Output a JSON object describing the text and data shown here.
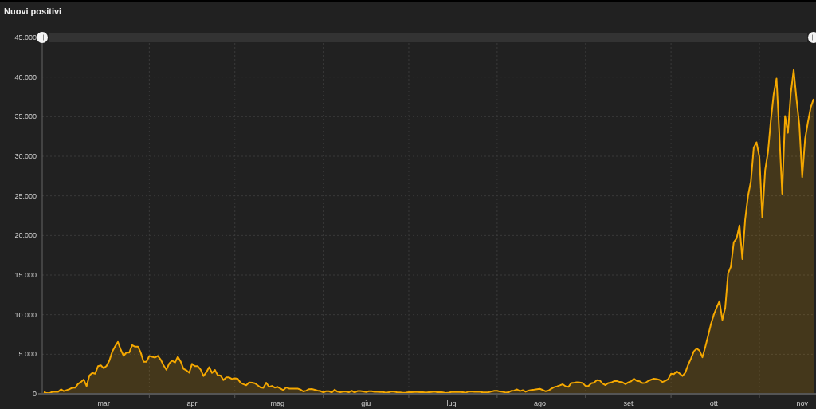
{
  "chart_data": {
    "type": "area",
    "title": "Nuovi positivi",
    "categories": [
      null,
      null,
      null,
      null,
      null,
      null,
      null,
      null,
      null,
      null,
      null,
      null,
      null,
      null,
      null,
      null,
      null,
      null,
      null,
      null,
      null,
      "mar",
      null,
      null,
      null,
      null,
      null,
      null,
      null,
      null,
      null,
      null,
      null,
      null,
      null,
      null,
      null,
      null,
      null,
      null,
      null,
      null,
      null,
      null,
      null,
      null,
      null,
      null,
      null,
      null,
      null,
      null,
      "apr",
      null,
      null,
      null,
      null,
      null,
      null,
      null,
      null,
      null,
      null,
      null,
      null,
      null,
      null,
      null,
      null,
      null,
      null,
      null,
      null,
      null,
      null,
      null,
      null,
      null,
      null,
      null,
      null,
      null,
      "mag",
      null,
      null,
      null,
      null,
      null,
      null,
      null,
      null,
      null,
      null,
      null,
      null,
      null,
      null,
      null,
      null,
      null,
      null,
      null,
      null,
      null,
      null,
      null,
      null,
      null,
      null,
      null,
      null,
      null,
      null,
      "giu",
      null,
      null,
      null,
      null,
      null,
      null,
      null,
      null,
      null,
      null,
      null,
      null,
      null,
      null,
      null,
      null,
      null,
      null,
      null,
      null,
      null,
      null,
      null,
      null,
      null,
      null,
      null,
      null,
      null,
      "lug",
      null,
      null,
      null,
      null,
      null,
      null,
      null,
      null,
      null,
      null,
      null,
      null,
      null,
      null,
      null,
      null,
      null,
      null,
      null,
      null,
      null,
      null,
      null,
      null,
      null,
      null,
      null,
      null,
      null,
      null,
      "ago",
      null,
      null,
      null,
      null,
      null,
      null,
      null,
      null,
      null,
      null,
      null,
      null,
      null,
      null,
      null,
      null,
      null,
      null,
      null,
      null,
      null,
      null,
      null,
      null,
      null,
      null,
      null,
      null,
      null,
      null,
      "set",
      null,
      null,
      null,
      null,
      null,
      null,
      null,
      null,
      null,
      null,
      null,
      null,
      null,
      null,
      null,
      null,
      null,
      null,
      null,
      null,
      null,
      null,
      null,
      null,
      null,
      null,
      null,
      null,
      null,
      "ott",
      null,
      null,
      null,
      null,
      null,
      null,
      null,
      null,
      null,
      null,
      null,
      null,
      null,
      null,
      null,
      null,
      null,
      null,
      null,
      null,
      null,
      null,
      null,
      null,
      null,
      null,
      null,
      null,
      null,
      null,
      "nov",
      null,
      null,
      null,
      null
    ],
    "series": [
      {
        "color": "#f5a800",
        "values": [
          221,
          93,
          78,
          250,
          238,
          240,
          566,
          342,
          466,
          587,
          769,
          778,
          1247,
          1492,
          1797,
          977,
          2313,
          2651,
          2547,
          3497,
          3590,
          3233,
          3526,
          4207,
          5322,
          5986,
          6557,
          5560,
          4789,
          5249,
          5210,
          6153,
          5959,
          5974,
          5217,
          4050,
          4053,
          4782,
          4668,
          4585,
          4805,
          4316,
          3599,
          3039,
          3836,
          4204,
          3951,
          4694,
          4092,
          3153,
          2972,
          2667,
          3786,
          3493,
          3491,
          3047,
          2256,
          2729,
          3370,
          2646,
          3021,
          2357,
          2324,
          1739,
          2091,
          2086,
          1872,
          1965,
          1900,
          1389,
          1221,
          1075,
          1444,
          1401,
          1327,
          1083,
          802,
          744,
          1402,
          888,
          992,
          789,
          875,
          675,
          451,
          813,
          665,
          642,
          652,
          669,
          531,
          300,
          397,
          584,
          593,
          516,
          416,
          355,
          178,
          318,
          321,
          177,
          518,
          270,
          197,
          280,
          283,
          202,
          379,
          163,
          346,
          338,
          301,
          210,
          329,
          333,
          251,
          262,
          224,
          218,
          122,
          190,
          296,
          259,
          175,
          174,
          126,
          142,
          187,
          201,
          223,
          235,
          192,
          208,
          138,
          193,
          229,
          276,
          188,
          234,
          169,
          114,
          162,
          230,
          233,
          249,
          219,
          190,
          129,
          282,
          306,
          252,
          275,
          255,
          170,
          181,
          212,
          289,
          386,
          379,
          295,
          239,
          159,
          190,
          384,
          402,
          552,
          347,
          463,
          259,
          412,
          481,
          523,
          574,
          629,
          479,
          320,
          403,
          642,
          845,
          947,
          1071,
          1210,
          953,
          878,
          1367,
          1411,
          1462,
          1444,
          1365,
          996,
          978,
          1326,
          1397,
          1733,
          1695,
          1297,
          1108,
          1370,
          1434,
          1597,
          1616,
          1501,
          1458,
          1229,
          1452,
          1585,
          1907,
          1638,
          1587,
          1350,
          1392,
          1640,
          1786,
          1912,
          1869,
          1766,
          1494,
          1648,
          1851,
          2548,
          2499,
          2844,
          2578,
          2257,
          2677,
          3678,
          4458,
          5372,
          5724,
          5456,
          4619,
          5901,
          7332,
          8804,
          10010,
          10925,
          11705,
          9338,
          10874,
          15199,
          16079,
          19143,
          19644,
          21273,
          17012,
          21994,
          24991,
          26831,
          31084,
          31758,
          29907,
          22253,
          28244,
          30550,
          34505,
          37809,
          39811,
          32616,
          25271,
          35098,
          32961,
          37978,
          40902,
          37255,
          33979,
          27354,
          32191,
          34283,
          36176,
          37242
        ]
      }
    ],
    "ylim": [
      0,
      45000
    ],
    "grid": true,
    "yticks": [
      {
        "value": 0,
        "label": "0"
      },
      {
        "value": 5000,
        "label": "5.000"
      },
      {
        "value": 10000,
        "label": "10.000"
      },
      {
        "value": 15000,
        "label": "15.000"
      },
      {
        "value": 20000,
        "label": "20.000"
      },
      {
        "value": 25000,
        "label": "25.000"
      },
      {
        "value": 30000,
        "label": "30.000"
      },
      {
        "value": 35000,
        "label": "35.000"
      },
      {
        "value": 40000,
        "label": "40.000"
      },
      {
        "value": 45000,
        "label": "45.000"
      }
    ]
  }
}
